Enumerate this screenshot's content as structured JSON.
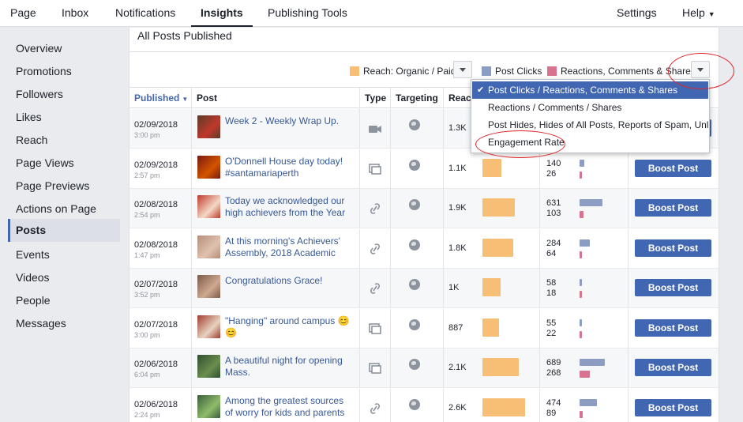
{
  "topnav": {
    "items": [
      "Page",
      "Inbox",
      "Notifications",
      "Insights",
      "Publishing Tools"
    ],
    "settings": "Settings",
    "help": "Help"
  },
  "sidebar": {
    "items": [
      "Overview",
      "Promotions",
      "Followers",
      "Likes",
      "Reach",
      "Page Views",
      "Page Previews",
      "Actions on Page",
      "Posts",
      "Events",
      "Videos",
      "People",
      "Messages"
    ],
    "active": "Posts"
  },
  "main": {
    "title": "All Posts Published",
    "legend": {
      "reach": "Reach: Organic / Paid",
      "clicks": "Post Clicks",
      "reactions": "Reactions, Comments & Shares"
    }
  },
  "table": {
    "headers": [
      "Published",
      "Post",
      "Type",
      "Targeting",
      "Reach"
    ],
    "boost_label": "Boost Post",
    "rows": [
      {
        "date": "02/09/2018",
        "time": "3:00 pm",
        "text": "Week 2 - Weekly Wrap Up.",
        "type": "video-icon",
        "reach": "1.3K",
        "reach_fraction": 0.55,
        "clicks": "",
        "reactions": "",
        "clicks_fraction": 0,
        "reactions_fraction": 0
      },
      {
        "date": "02/09/2018",
        "time": "2:57 pm",
        "text": "O'Donnell House day today! #santamariaperth #smc80years",
        "type": "album-icon",
        "reach": "1.1K",
        "reach_fraction": 0.45,
        "clicks": "140",
        "reactions": "26",
        "clicks_fraction": 0.2,
        "reactions_fraction": 0.06
      },
      {
        "date": "02/08/2018",
        "time": "2:54 pm",
        "text": "Today we acknowledged our high achievers from the Year 12 Class",
        "type": "link-icon",
        "reach": "1.9K",
        "reach_fraction": 0.75,
        "clicks": "631",
        "reactions": "103",
        "clicks_fraction": 0.9,
        "reactions_fraction": 0.15
      },
      {
        "date": "02/08/2018",
        "time": "1:47 pm",
        "text": "At this morning's Achievers' Assembly, 2018 Academic Captain, Es",
        "type": "link-icon",
        "reach": "1.8K",
        "reach_fraction": 0.72,
        "clicks": "284",
        "reactions": "64",
        "clicks_fraction": 0.4,
        "reactions_fraction": 0.1
      },
      {
        "date": "02/07/2018",
        "time": "3:52 pm",
        "text": "Congratulations Grace!",
        "type": "link-icon",
        "reach": "1K",
        "reach_fraction": 0.42,
        "clicks": "58",
        "reactions": "18",
        "clicks_fraction": 0.08,
        "reactions_fraction": 0.04
      },
      {
        "date": "02/07/2018",
        "time": "3:00 pm",
        "text": "\"Hanging\" around campus 😊😊",
        "type": "album-icon",
        "reach": "887",
        "reach_fraction": 0.38,
        "clicks": "55",
        "reactions": "22",
        "clicks_fraction": 0.08,
        "reactions_fraction": 0.05
      },
      {
        "date": "02/06/2018",
        "time": "6:04 pm",
        "text": "A beautiful night for opening Mass.",
        "type": "album-icon",
        "reach": "2.1K",
        "reach_fraction": 0.85,
        "clicks": "689",
        "reactions": "268",
        "clicks_fraction": 1.0,
        "reactions_fraction": 0.4
      },
      {
        "date": "02/06/2018",
        "time": "2:24 pm",
        "text": "Among the greatest sources of worry for kids and parents about sc",
        "type": "link-icon",
        "reach": "2.6K",
        "reach_fraction": 1.0,
        "clicks": "474",
        "reactions": "89",
        "clicks_fraction": 0.7,
        "reactions_fraction": 0.13
      }
    ]
  },
  "dropdown": {
    "items": [
      "Post Clicks / Reactions, Comments & Shares",
      "Reactions / Comments / Shares",
      "Post Hides, Hides of All Posts, Reports of Spam, Unl...",
      "Engagement Rate"
    ],
    "selected_index": 0,
    "check": "✔"
  },
  "colors": {
    "reach": "#f7bf75",
    "clicks": "#8b9dc3",
    "reactions": "#d7738f",
    "accent": "#4267b2",
    "annotation": "#e0242a"
  }
}
